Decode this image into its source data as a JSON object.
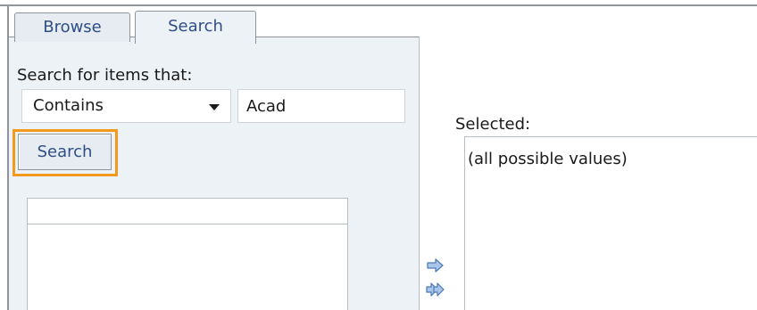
{
  "tabs": [
    {
      "label": "Browse"
    },
    {
      "label": "Search"
    }
  ],
  "search_panel": {
    "heading": "Search for items that:",
    "condition": {
      "selected": "Contains"
    },
    "query": {
      "value": "Acad"
    },
    "search_button_label": "Search"
  },
  "selected_panel": {
    "heading": "Selected:",
    "items": [
      "(all possible values)"
    ]
  },
  "icons": {
    "add": "arrow-right-icon",
    "add_all": "double-arrow-right-icon"
  },
  "colors": {
    "tab_text": "#2f4e86",
    "panel_bg": "#edf2f6",
    "highlight": "#f39a1c"
  }
}
